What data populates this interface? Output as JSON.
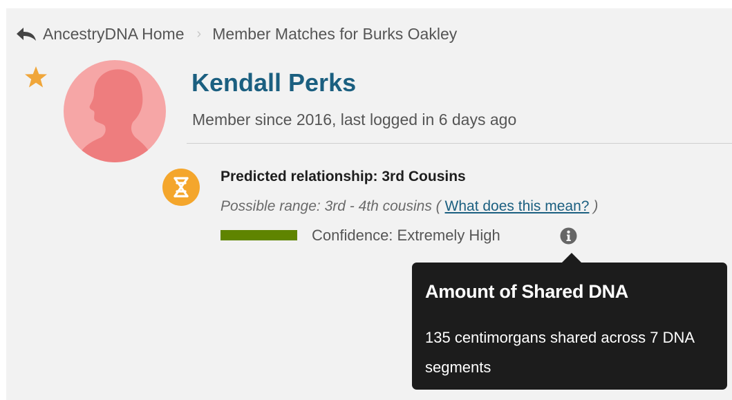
{
  "breadcrumb": {
    "back_icon": "reply-arrow-icon",
    "home_link": "AncestryDNA Home",
    "separator": "›",
    "current": "Member Matches for Burks Oakley"
  },
  "profile": {
    "star_icon": "star-icon",
    "star_color": "#f0a63a",
    "avatar_icon": "female-silhouette-icon",
    "avatar_color": "#f6a6a6",
    "name": "Kendall Perks",
    "name_color": "#1b5f80",
    "member_since": "Member since 2016, last logged in 6 days ago"
  },
  "relationship": {
    "dna_icon": "dna-helix-icon",
    "badge_color": "#f4a62c",
    "predicted": "Predicted relationship: 3rd Cousins",
    "range_prefix": "Possible range: 3rd - 4th cousins (",
    "range_link": "What does this mean?",
    "range_suffix": ")",
    "confidence_label": "Confidence: Extremely High",
    "confidence_color": "#5f8400",
    "info_icon": "info-icon"
  },
  "tooltip": {
    "title": "Amount of Shared DNA",
    "body": "135 centimorgans shared across 7 DNA segments",
    "background": "#1c1c1c"
  }
}
